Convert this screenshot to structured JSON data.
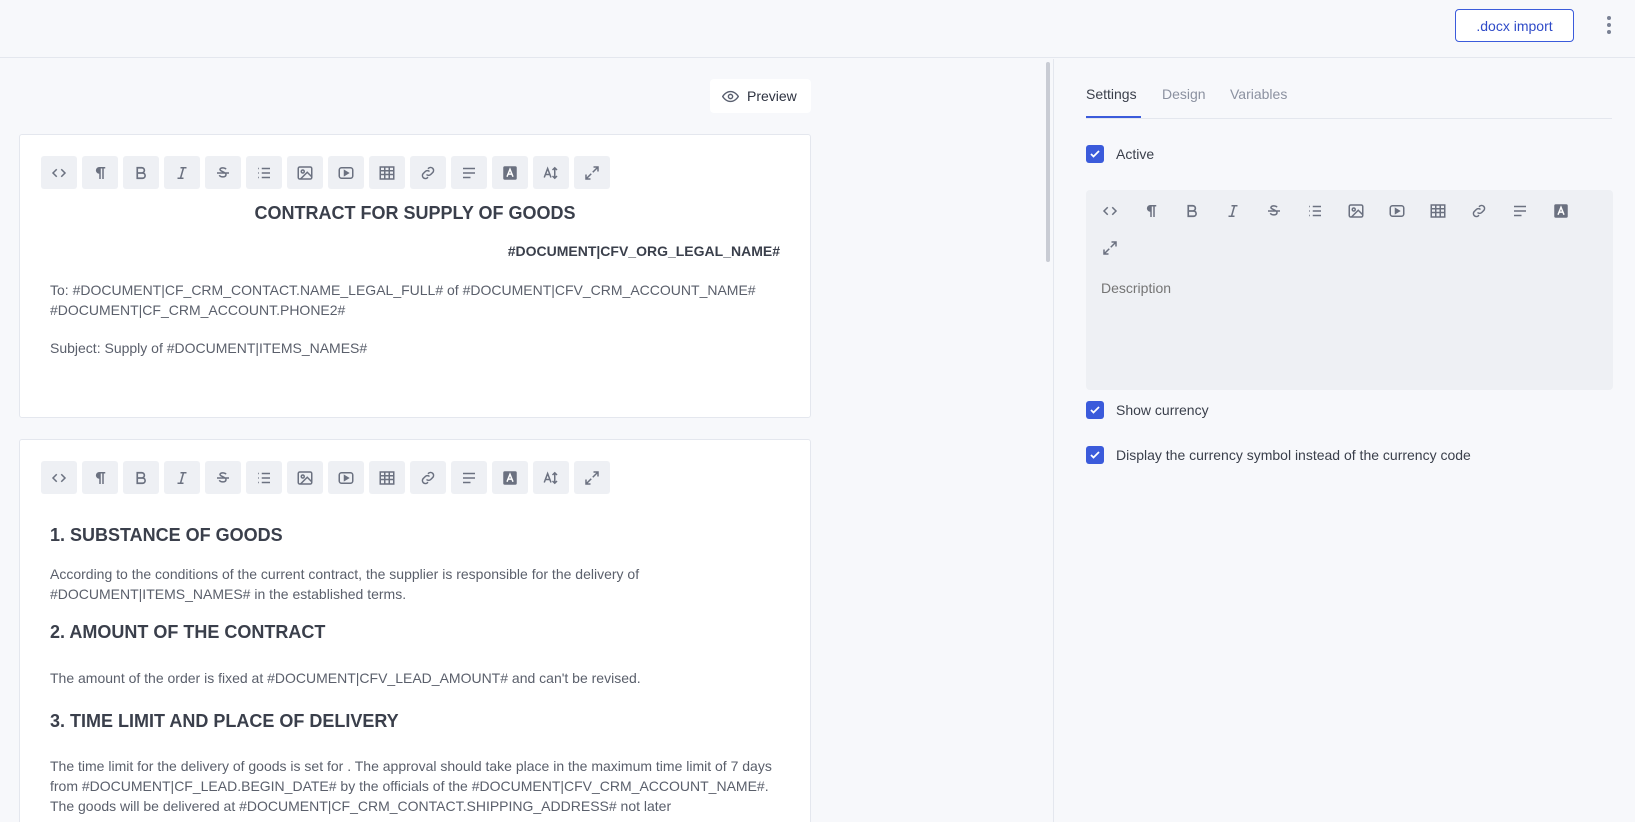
{
  "topbar": {
    "docx_import_label": ".docx import"
  },
  "left": {
    "preview_label": "Preview",
    "editor1": {
      "title": "CONTRACT FOR SUPPLY OF GOODS",
      "org": "#DOCUMENT|CFV_ORG_LEGAL_NAME#",
      "to_line": "To: #DOCUMENT|CF_CRM_CONTACT.NAME_LEGAL_FULL# of #DOCUMENT|CFV_CRM_ACCOUNT_NAME# #DOCUMENT|CF_CRM_ACCOUNT.PHONE2#",
      "subject": "Subject: Supply of #DOCUMENT|ITEMS_NAMES#"
    },
    "editor2": {
      "h1": "1. SUBSTANCE OF GOODS",
      "p1": "According to the conditions of the current contract, the supplier is responsible for the delivery of #DOCUMENT|ITEMS_NAMES# in the established terms.",
      "h2": "2. AMOUNT OF THE CONTRACT",
      "p2": "The amount of the order is fixed at #DOCUMENT|CFV_LEAD_AMOUNT# and can't be revised.",
      "h3": "3. TIME LIMIT AND PLACE OF DELIVERY",
      "p3": "The time limit for the delivery of goods is set for . The approval should take place in the maximum time limit of 7 days from #DOCUMENT|CF_LEAD.BEGIN_DATE#  by the officials of the #DOCUMENT|CFV_CRM_ACCOUNT_NAME#. The goods will be delivered at #DOCUMENT|CF_CRM_CONTACT.SHIPPING_ADDRESS# not later"
    },
    "toolbar_icons": [
      "code-icon",
      "paragraph-icon",
      "bold-icon",
      "italic-icon",
      "strikethrough-icon",
      "list-icon",
      "image-icon",
      "video-icon",
      "table-icon",
      "link-icon",
      "align-icon",
      "text-color-icon",
      "font-size-icon",
      "fullscreen-icon"
    ]
  },
  "right": {
    "tabs": [
      {
        "label": "Settings",
        "active": true
      },
      {
        "label": "Design",
        "active": false
      },
      {
        "label": "Variables",
        "active": false
      }
    ],
    "active_label": "Active",
    "active_checked": true,
    "description_placeholder": "Description",
    "show_currency_label": "Show currency",
    "show_currency_checked": true,
    "currency_symbol_label": "Display the currency symbol instead of the currency code",
    "currency_symbol_checked": true
  },
  "colors": {
    "accent": "#3b5bdb",
    "background": "#f7f8fb",
    "toolbar_button": "#eef0f4"
  }
}
